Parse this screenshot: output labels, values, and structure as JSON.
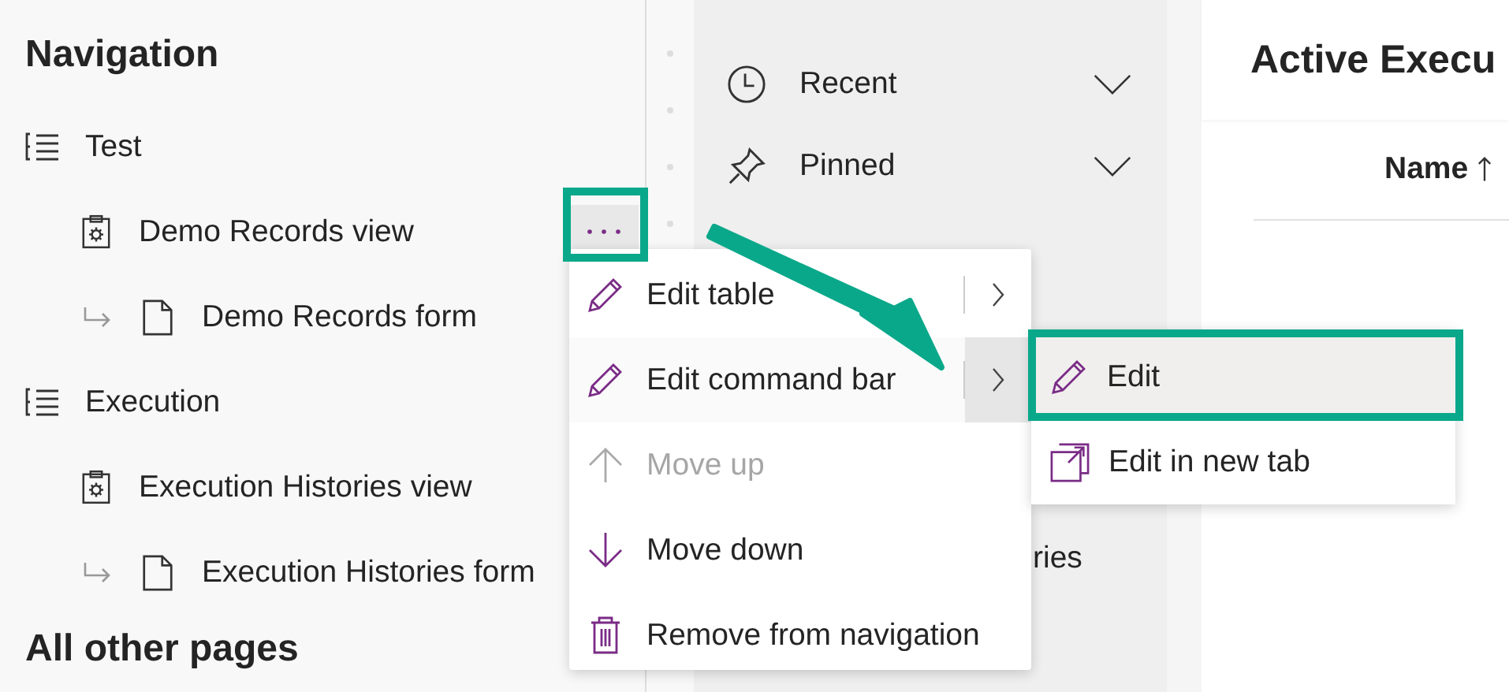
{
  "navigation": {
    "title": "Navigation",
    "groups": [
      {
        "label": "Test",
        "items": [
          {
            "label": "Demo Records view",
            "kind": "view",
            "more_button": true
          },
          {
            "label": "Demo Records form",
            "kind": "form"
          }
        ]
      },
      {
        "label": "Execution",
        "items": [
          {
            "label": "Execution Histories view",
            "kind": "view"
          },
          {
            "label": "Execution Histories form",
            "kind": "form"
          }
        ]
      }
    ]
  },
  "all_other_pages": {
    "title": "All other pages"
  },
  "app_nav": {
    "items": [
      {
        "label": "Recent",
        "kind": "recent",
        "expanded": false
      },
      {
        "label": "Pinned",
        "kind": "pinned",
        "expanded": false
      }
    ],
    "partial_item": "ries"
  },
  "main": {
    "title": "Active Execu",
    "columns": [
      {
        "label": "Name",
        "sort_ascending": true
      }
    ]
  },
  "context_menu": {
    "items": [
      {
        "label": "Edit table",
        "kind": "edit",
        "disabled": false,
        "submenu": true,
        "expanded": false
      },
      {
        "label": "Edit command bar",
        "kind": "edit",
        "disabled": false,
        "submenu": true,
        "expanded": true
      },
      {
        "label": "Move up",
        "kind": "up",
        "disabled": true,
        "submenu": false
      },
      {
        "label": "Move down",
        "kind": "down",
        "disabled": false,
        "submenu": false
      },
      {
        "label": "Remove from navigation",
        "kind": "delete",
        "disabled": false,
        "submenu": false
      }
    ]
  },
  "submenu": {
    "items": [
      {
        "label": "Edit",
        "kind": "edit",
        "selected": true
      },
      {
        "label": "Edit in new tab",
        "kind": "open",
        "selected": false
      }
    ]
  }
}
